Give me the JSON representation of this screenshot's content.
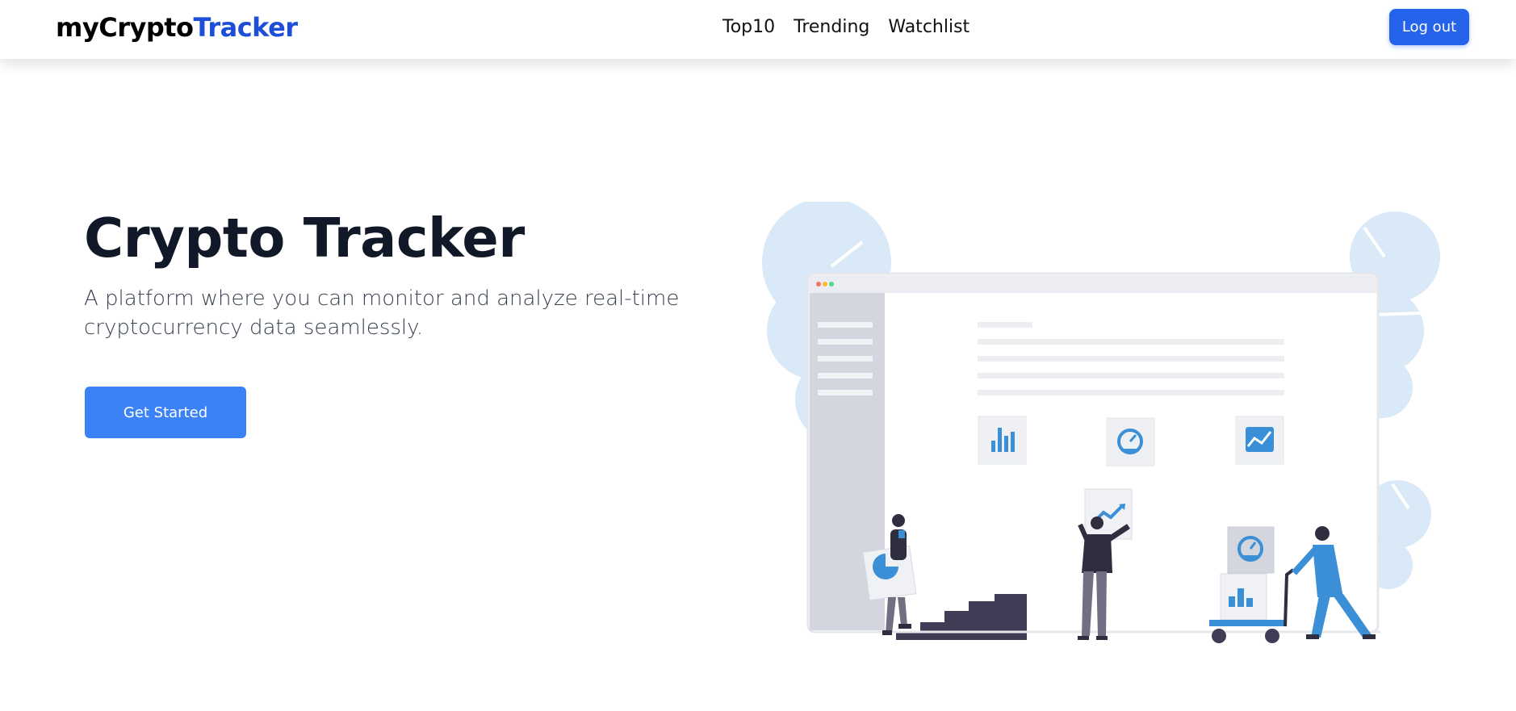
{
  "nav": {
    "brand_primary": "myCrypto",
    "brand_accent": "Tracker",
    "links": [
      {
        "label": "Top10"
      },
      {
        "label": "Trending"
      },
      {
        "label": "Watchlist"
      }
    ],
    "logout_label": "Log out"
  },
  "hero": {
    "title": "Crypto Tracker",
    "subtitle": "A platform where you can monitor and analyze real-time cryptocurrency data seamlessly.",
    "cta_label": "Get Started"
  },
  "colors": {
    "brand_accent": "#1d4ed8",
    "primary_button": "#2563eb",
    "cta_button": "#3b82f6",
    "illustration_blue": "#3b8fd6",
    "illustration_dark": "#3f3d56"
  },
  "illustration": {
    "icons": [
      "bar-chart-icon",
      "gauge-icon",
      "line-chart-icon",
      "trend-up-icon",
      "pie-chart-icon"
    ]
  }
}
